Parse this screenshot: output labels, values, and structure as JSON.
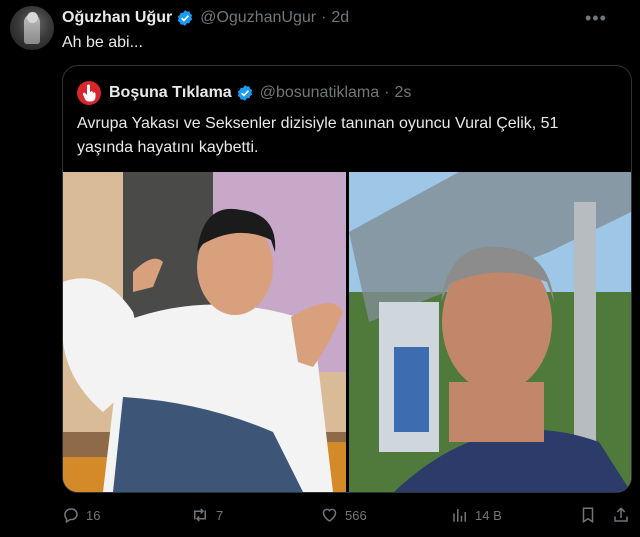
{
  "tweet": {
    "author_name": "Oğuzhan Uğur",
    "author_handle": "@OguzhanUgur",
    "time": "2d",
    "text": "Ah be abi..."
  },
  "quoted": {
    "author_name": "Boşuna Tıklama",
    "author_handle": "@bosunatiklama",
    "time": "2s",
    "text": "Avrupa Yakası ve Seksenler dizisiyle tanınan oyuncu Vural Çelik, 51 yaşında hayatını kaybetti."
  },
  "actions": {
    "replies": "16",
    "reposts": "7",
    "likes": "566",
    "views": "14 B"
  },
  "colors": {
    "verified": "#1d9bf0",
    "muted": "#71767b",
    "accent": "#d8262c"
  },
  "icons": [
    "more-icon",
    "verified-icon",
    "reply-icon",
    "repost-icon",
    "like-icon",
    "views-icon",
    "bookmark-icon",
    "share-icon"
  ]
}
